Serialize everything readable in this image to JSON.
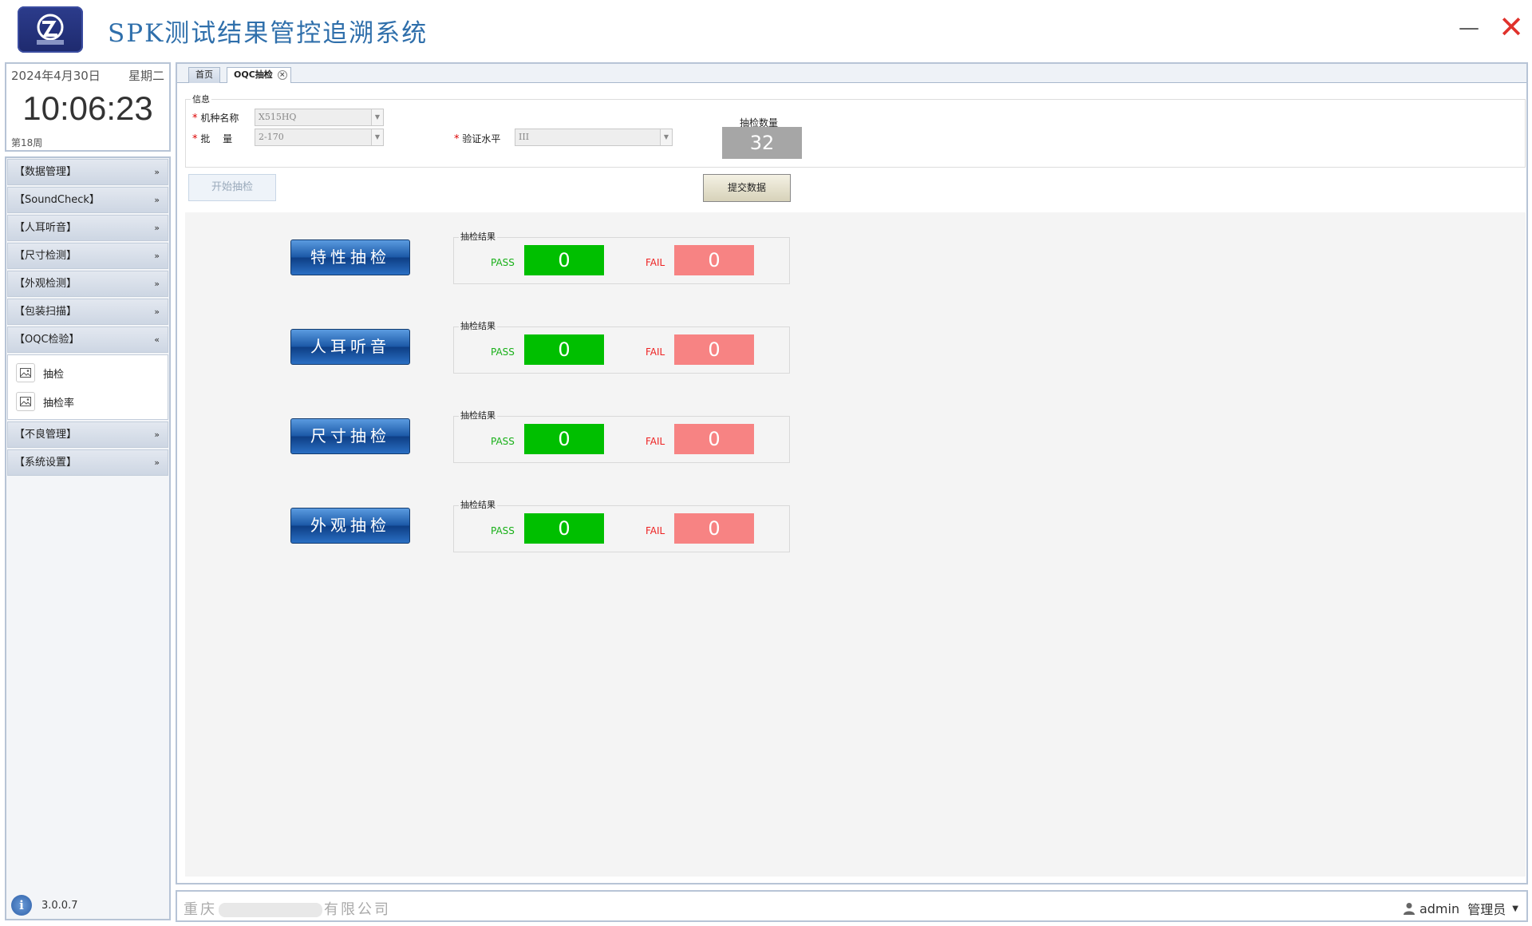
{
  "app": {
    "title": "SPK测试结果管控追溯系统"
  },
  "window": {
    "minimize": "—",
    "close": "✕"
  },
  "clock": {
    "date": "2024年4月30日",
    "weekday": "星期二",
    "time": "10:06:23",
    "week_no": "第18周"
  },
  "nav": {
    "items": [
      {
        "label": "【数据管理】",
        "chevron": "»"
      },
      {
        "label": "【SoundCheck】",
        "chevron": "»"
      },
      {
        "label": "【人耳听音】",
        "chevron": "»"
      },
      {
        "label": "【尺寸检测】",
        "chevron": "»"
      },
      {
        "label": "【外观检测】",
        "chevron": "»"
      },
      {
        "label": "【包装扫描】",
        "chevron": "»"
      },
      {
        "label": "【OQC检验】",
        "chevron": "«"
      }
    ],
    "sub_items": [
      {
        "label": "抽检"
      },
      {
        "label": "抽检率"
      }
    ],
    "items_after": [
      {
        "label": "【不良管理】",
        "chevron": "»"
      },
      {
        "label": "【系统设置】",
        "chevron": "»"
      }
    ]
  },
  "version": "3.0.0.7",
  "tabs": {
    "home": "首页",
    "oqc": "OQC抽检"
  },
  "info": {
    "group_label": "信息",
    "model_label": "机种名称",
    "model_value": "X515HQ",
    "batch_label": "批 量",
    "batch_value": "2-170",
    "level_label": "验证水平",
    "level_value": "III",
    "count_label": "抽检数量",
    "count_value": "32"
  },
  "buttons": {
    "start": "开始抽检",
    "submit": "提交数据"
  },
  "checks": [
    {
      "label": "特性抽检",
      "result_label": "抽检结果",
      "pass_label": "PASS",
      "pass": "0",
      "fail_label": "FAIL",
      "fail": "0"
    },
    {
      "label": "人耳听音",
      "result_label": "抽检结果",
      "pass_label": "PASS",
      "pass": "0",
      "fail_label": "FAIL",
      "fail": "0"
    },
    {
      "label": "尺寸抽检",
      "result_label": "抽检结果",
      "pass_label": "PASS",
      "pass": "0",
      "fail_label": "FAIL",
      "fail": "0"
    },
    {
      "label": "外观抽检",
      "result_label": "抽检结果",
      "pass_label": "PASS",
      "pass": "0",
      "fail_label": "FAIL",
      "fail": "0"
    }
  ],
  "footer": {
    "company_prefix": "重庆",
    "company_suffix": "有限公司",
    "user": "admin",
    "role": "管理员"
  },
  "colors": {
    "title": "#2f6fab",
    "pass": "#00bf00",
    "fail": "#f78383",
    "close": "#e0322c"
  }
}
